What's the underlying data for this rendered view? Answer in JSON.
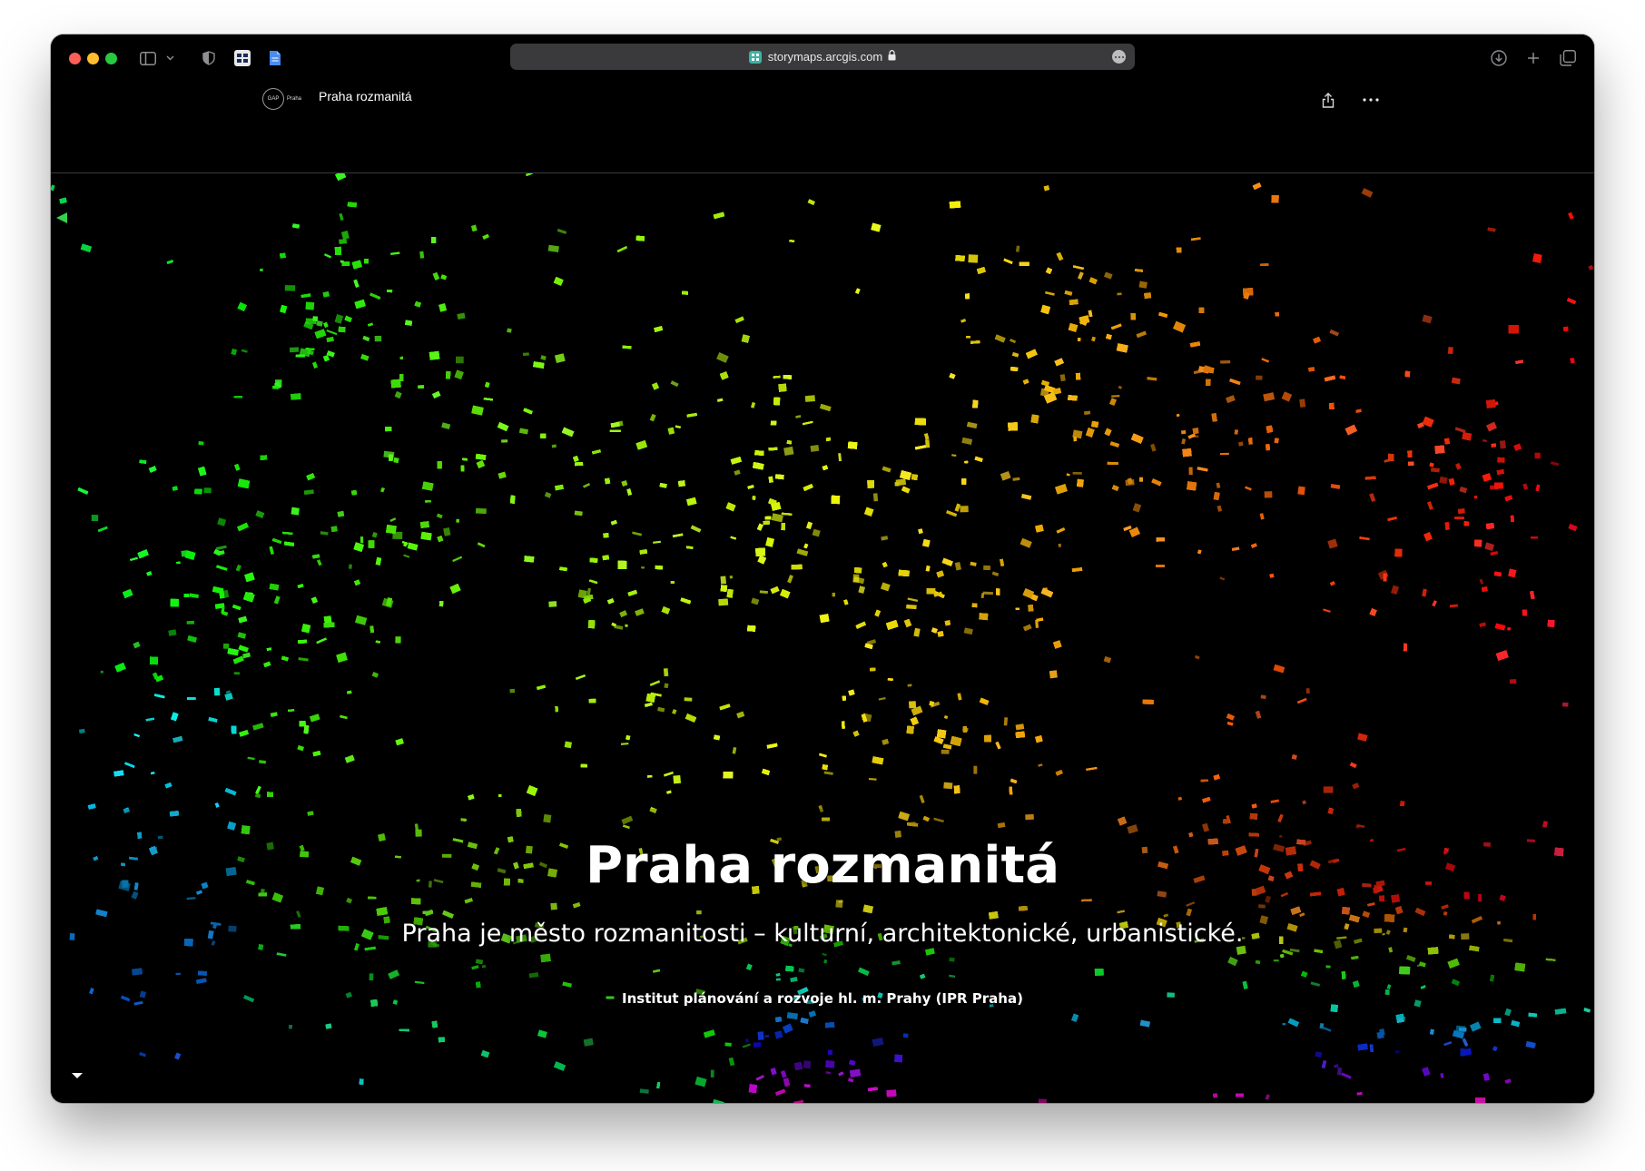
{
  "browser": {
    "url": "storymaps.arcgis.com"
  },
  "story": {
    "header_title": "Praha rozmanitá",
    "logo_text": "GAP",
    "logo_sub": "Praha"
  },
  "hero": {
    "title": "Praha rozmanitá",
    "subtitle": "Praha je město rozmanitosti – kulturní, architektonické, urbanistické.",
    "byline": "Institut plánování a rozvoje hl. m. Prahy (IPR Praha)"
  },
  "colors": {
    "accent_green": "#28c840",
    "map_palette": [
      "#1a66ff",
      "#12c4a8",
      "#22c93c",
      "#7ce81a",
      "#e8e81a",
      "#ff9a1a",
      "#ff3a1a",
      "#d01ab0"
    ]
  },
  "icons": [
    "sidebar-icon",
    "chevron-down-icon",
    "shield-icon",
    "extension-icon",
    "document-icon",
    "lock-icon",
    "more-icon",
    "download-icon",
    "plus-icon",
    "tabs-icon",
    "share-icon",
    "ellipsis-icon"
  ]
}
